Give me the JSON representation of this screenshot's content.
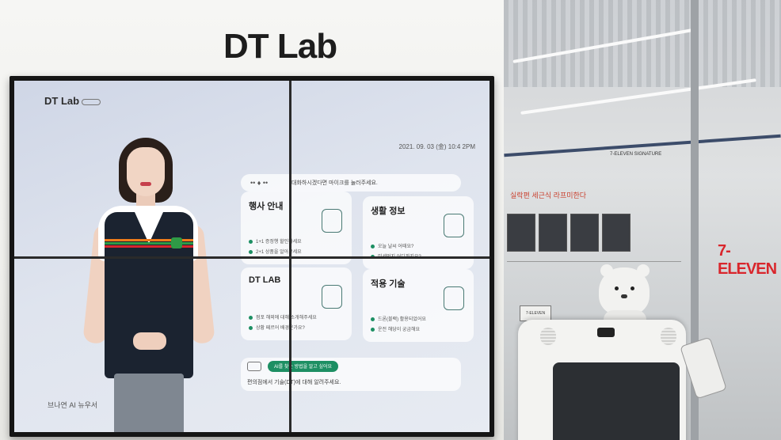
{
  "wall": {
    "logo": "DT Lab"
  },
  "screen": {
    "logo": "DT Lab",
    "date": "2021. 09. 03 (金)  10:4 2PM",
    "caption": "브나연 AI 뉴우서",
    "header_text": "대화하시겠다면 마이크를 눌러주세요.",
    "cards": [
      {
        "title": "행사 안내",
        "lines": [
          "1+1 증정행 할인하세요",
          "2+1 상품을 알아보세요"
        ]
      },
      {
        "title": "생활 정보",
        "lines": [
          "오늘 날씨 어때요?",
          "미세먼지 어디까지요?"
        ]
      },
      {
        "title": "DT LAB",
        "lines": [
          "점포 해외에 대해 소개해주세요",
          "상황 페르어 배경운가요?"
        ]
      },
      {
        "title": "적용 기술",
        "lines": [
          "드론(블랙) 활용되었어요",
          "운전 해당이 궁금해요"
        ]
      }
    ],
    "footer_pill": "AI를 찾는 방법을 알고 싶어요",
    "footer_text": "편의점에서 기술(DT)에 대해 알려주세요."
  },
  "store": {
    "sign": "7-ELEVEN",
    "red_text": "실락편 세근식 라프미한다",
    "window_sign": "7-ELEVEN\nSIGNATURE",
    "kiosk_label": "7-ELEVEN"
  },
  "colors": {
    "accent_green": "#1d8f63",
    "brand_red": "#d9262c",
    "brand_green": "#1c7a3a"
  }
}
